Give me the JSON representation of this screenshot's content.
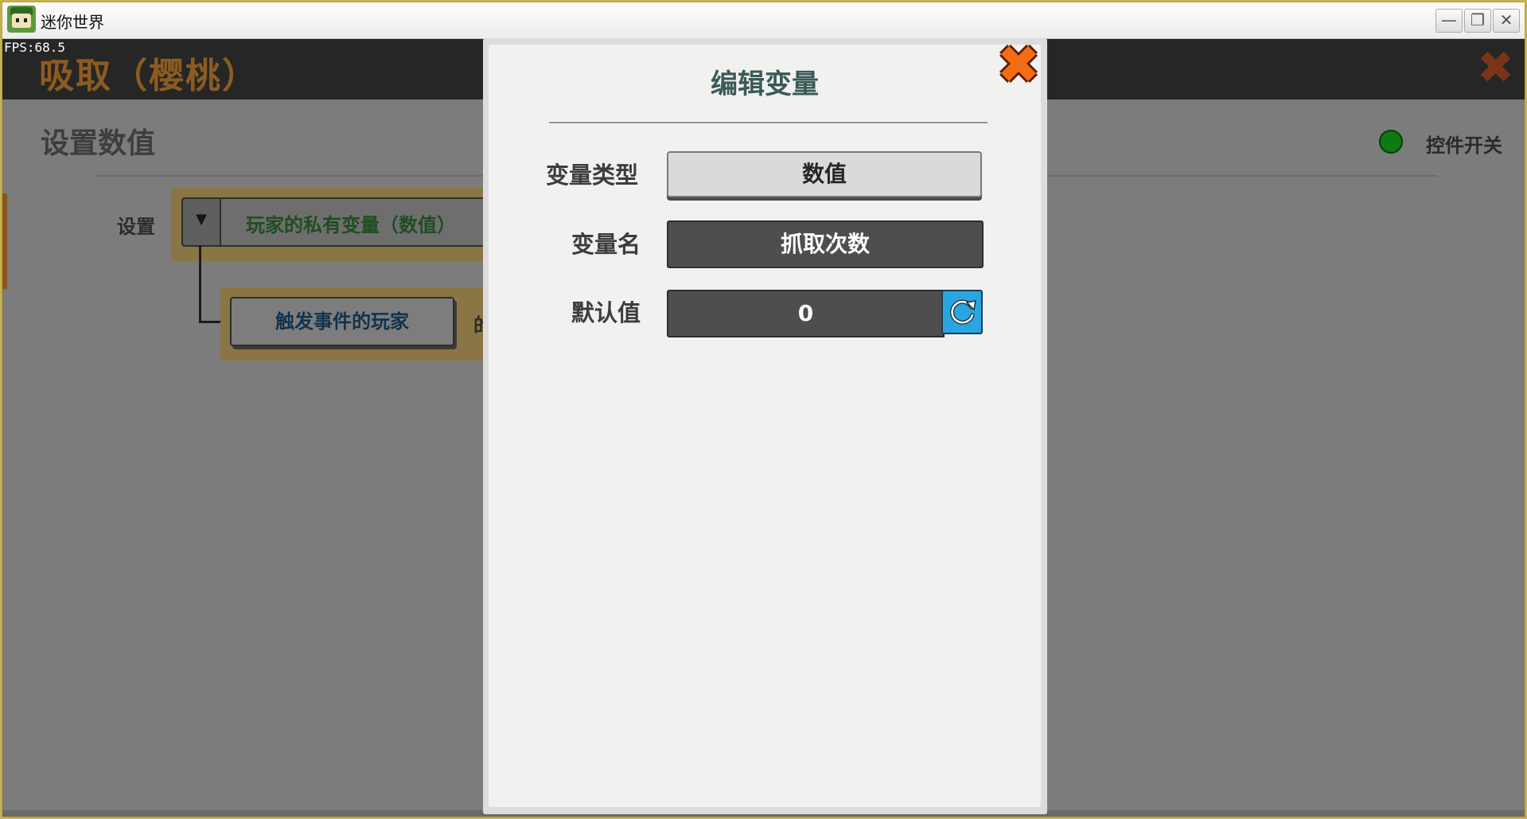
{
  "window": {
    "title": "迷你世界",
    "minimize_glyph": "—",
    "maximize_glyph": "❐",
    "close_glyph": "✕"
  },
  "game": {
    "fps": "FPS:68.5",
    "page_title": "吸取（樱桃）",
    "close_glyph": "✖"
  },
  "panel": {
    "section_title": "设置数值",
    "set_label": "设置",
    "variable_select": "玩家的私有变量（数值）",
    "dropdown_glyph": "▼",
    "player_button": "触发事件的玩家",
    "player_suffix": "的",
    "switch_label": "控件开关",
    "switch_color": "#0f7a12"
  },
  "modal": {
    "title": "编辑变量",
    "close_glyph": "✖",
    "type_label": "变量类型",
    "type_value": "数值",
    "name_label": "变量名",
    "name_value": "抓取次数",
    "default_label": "默认值",
    "default_value": "0",
    "reset_icon": "refresh-icon"
  },
  "colors": {
    "accent_orange": "#f36d16",
    "modal_title": "#3a5a57",
    "refresh_blue": "#29a5df"
  }
}
